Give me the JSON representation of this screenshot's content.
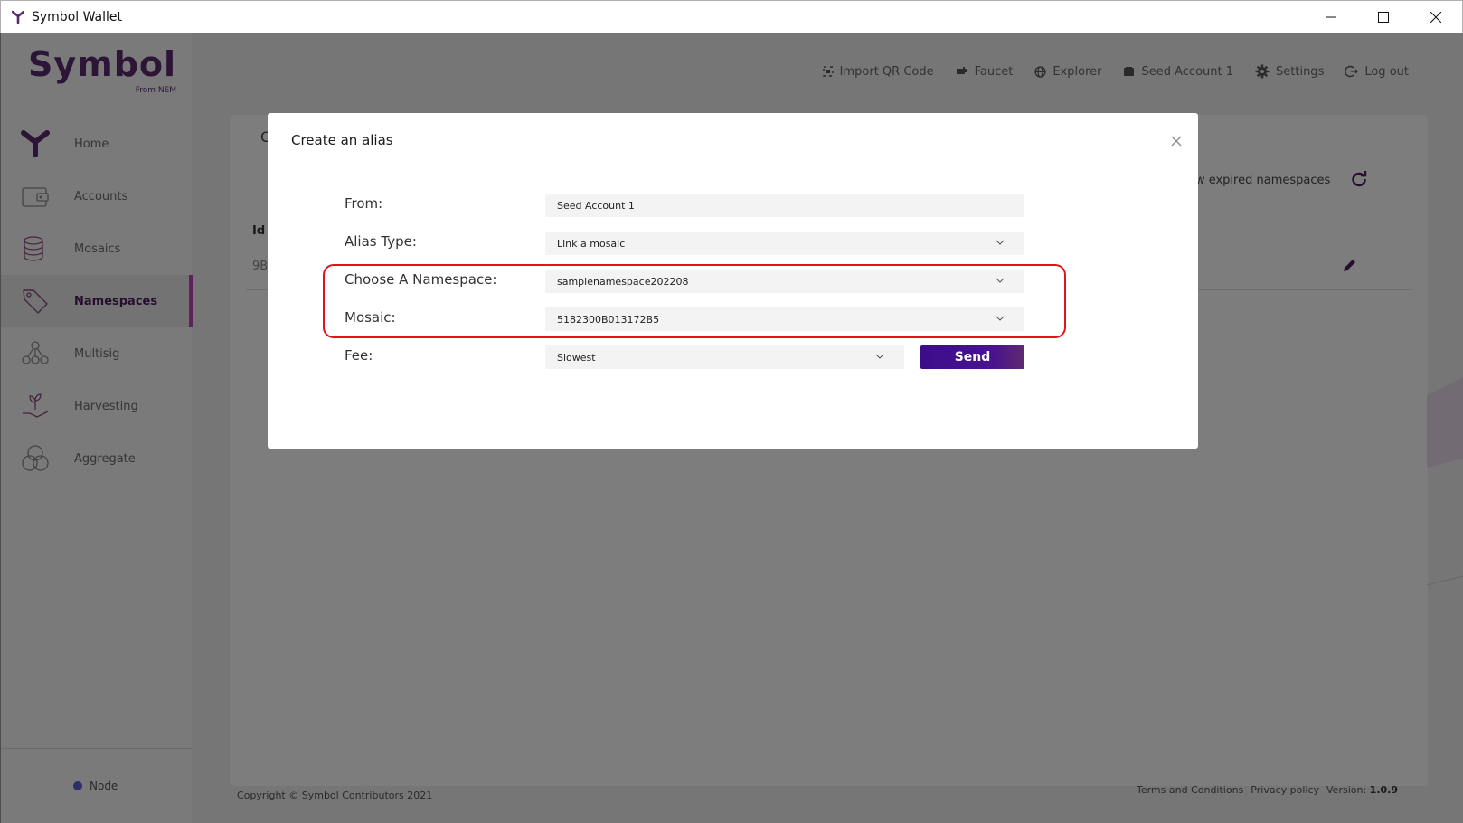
{
  "window": {
    "title": "Symbol Wallet"
  },
  "logo": {
    "brand": "Symbol",
    "sub": "From NEM"
  },
  "sidebar": {
    "items": [
      {
        "label": "Home",
        "icon": "home-icon"
      },
      {
        "label": "Accounts",
        "icon": "wallet-icon"
      },
      {
        "label": "Mosaics",
        "icon": "coins-icon"
      },
      {
        "label": "Namespaces",
        "icon": "tag-icon",
        "active": true
      },
      {
        "label": "Multisig",
        "icon": "network-icon"
      },
      {
        "label": "Harvesting",
        "icon": "plant-icon"
      },
      {
        "label": "Aggregate",
        "icon": "circles-icon"
      }
    ],
    "node_label": "Node"
  },
  "topnav": {
    "import_qr": "Import QR Code",
    "faucet": "Faucet",
    "explorer": "Explorer",
    "account": "Seed Account 1",
    "settings": "Settings",
    "logout": "Log out"
  },
  "background_page": {
    "title_fragment": "C",
    "show_expired": "ow expired namespaces",
    "col_id": "Id",
    "row_id_fragment": "9B"
  },
  "footer": {
    "copyright": "Copyright © Symbol Contributors 2021",
    "terms": "Terms and Conditions",
    "privacy": "Privacy policy",
    "version_label": "Version:",
    "version": "1.0.9"
  },
  "modal": {
    "title": "Create an alias",
    "from_label": "From:",
    "from_value": "Seed Account 1",
    "alias_type_label": "Alias Type:",
    "alias_type_value": "Link a mosaic",
    "namespace_label": "Choose A Namespace:",
    "namespace_value": "samplenamespace202208",
    "mosaic_label": "Mosaic:",
    "mosaic_value": "5182300B013172B5",
    "fee_label": "Fee:",
    "fee_value": "Slowest",
    "send_label": "Send"
  },
  "colors": {
    "brand_purple": "#5a2a6e",
    "active_accent": "#c145b9",
    "send_button": "#3b0d8a",
    "highlight": "#e0141d"
  }
}
